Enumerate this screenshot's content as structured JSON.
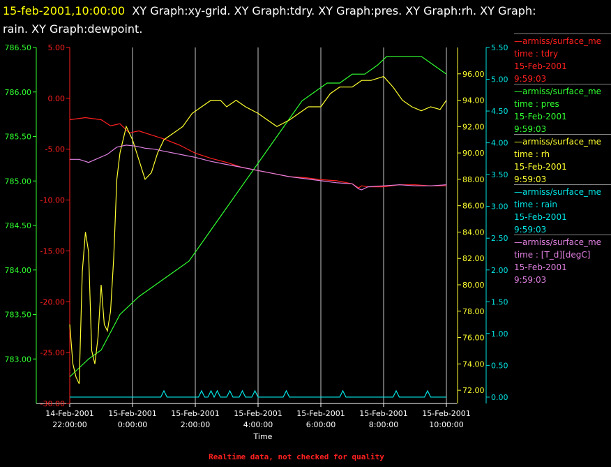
{
  "title": {
    "date": "15-feb-2001,10:00:00",
    "text_line1": "XY Graph:xy-grid.  XY Graph:tdry.  XY Graph:pres.  XY Graph:rh.  XY Graph:",
    "text_line2": "rain.  XY Graph:dewpoint."
  },
  "legend": [
    {
      "name": "armiss/surface_me",
      "var": "time : tdry",
      "date": "15-Feb-2001",
      "time": "9:59:03",
      "color": "#ff2020"
    },
    {
      "name": "armiss/surface_me",
      "var": "time : pres",
      "date": "15-Feb-2001",
      "time": "9:59:03",
      "color": "#30ff30"
    },
    {
      "name": "armiss/surface_me",
      "var": "time : rh",
      "date": "15-Feb-2001",
      "time": "9:59:03",
      "color": "#ffff30"
    },
    {
      "name": "armiss/surface_me",
      "var": "time : rain",
      "date": "15-Feb-2001",
      "time": "9:59:03",
      "color": "#00e5e5"
    },
    {
      "name": "armiss/surface_me",
      "var": "time : [T_d][degC]",
      "date": "15-Feb-2001",
      "time": "9:59:03",
      "color": "#e080e0"
    }
  ],
  "footer": "Realtime data, not checked for quality",
  "chart_data": {
    "type": "line",
    "xlabel": "Time",
    "x_domain_hours": [
      21.4,
      22.1
    ],
    "x_ticks": [
      {
        "value": 22,
        "line1": "14-Feb-2001",
        "line2": "22:00:00"
      },
      {
        "value": 24,
        "line1": "15-Feb-2001",
        "line2": "0:00:00"
      },
      {
        "value": 26,
        "line1": "15-Feb-2001",
        "line2": "2:00:00"
      },
      {
        "value": 28,
        "line1": "15-Feb-2001",
        "line2": "4:00:00"
      },
      {
        "value": 30,
        "line1": "15-Feb-2001",
        "line2": "6:00:00"
      },
      {
        "value": 32,
        "line1": "15-Feb-2001",
        "line2": "8:00:00"
      },
      {
        "value": 34,
        "line1": "15-Feb-2001",
        "line2": "10:00:00"
      }
    ],
    "x_range": [
      22,
      34
    ],
    "grid": "vertical",
    "axes": {
      "pres": {
        "range": [
          782.5,
          786.5
        ],
        "ticks": [
          "783.00",
          "783.50",
          "784.00",
          "784.50",
          "785.00",
          "785.50",
          "786.00",
          "786.50"
        ],
        "color": "#30ff30"
      },
      "tdry": {
        "range": [
          -30,
          5
        ],
        "ticks": [
          "-30.00",
          "-25.00",
          "-20.00",
          "-15.00",
          "-10.00",
          "-5.00",
          "0.00",
          "5.00"
        ],
        "color": "#ff2020"
      },
      "rh": {
        "range": [
          71,
          98
        ],
        "ticks": [
          "72.00",
          "74.00",
          "76.00",
          "78.00",
          "80.00",
          "82.00",
          "84.00",
          "86.00",
          "88.00",
          "90.00",
          "92.00",
          "94.00",
          "96.00"
        ],
        "color": "#ffff30"
      },
      "rain": {
        "range": [
          -0.1,
          5.5
        ],
        "ticks": [
          "0.00",
          "0.50",
          "1.00",
          "1.50",
          "2.00",
          "2.50",
          "3.00",
          "3.50",
          "4.00",
          "4.50",
          "5.00",
          "5.50"
        ],
        "color": "#00e5e5"
      }
    },
    "series": [
      {
        "name": "tdry",
        "axis": "tdry",
        "color": "#ff2020",
        "x": [
          22.0,
          22.5,
          23.0,
          23.3,
          23.6,
          23.9,
          24.2,
          24.6,
          25.0,
          25.5,
          26.0,
          26.5,
          27.0,
          27.5,
          28.0,
          28.5,
          29.0,
          29.5,
          30.0,
          30.5,
          31.0,
          31.2,
          31.3,
          31.5,
          32.0,
          32.5,
          33.0,
          33.5,
          34.0
        ],
        "y": [
          -2.1,
          -1.9,
          -2.1,
          -2.7,
          -2.5,
          -3.4,
          -3.2,
          -3.6,
          -4.0,
          -4.6,
          -5.4,
          -5.9,
          -6.3,
          -6.8,
          -7.1,
          -7.4,
          -7.7,
          -7.8,
          -8.0,
          -8.1,
          -8.4,
          -8.8,
          -8.6,
          -8.7,
          -8.7,
          -8.5,
          -8.5,
          -8.6,
          -8.6
        ]
      },
      {
        "name": "pres",
        "axis": "pres",
        "color": "#30ff30",
        "x": [
          22.0,
          22.3,
          22.6,
          23.0,
          23.3,
          23.6,
          23.9,
          24.2,
          24.6,
          25.0,
          25.4,
          25.8,
          26.2,
          26.6,
          27.0,
          27.4,
          27.8,
          28.2,
          28.6,
          29.0,
          29.4,
          29.8,
          30.2,
          30.6,
          31.0,
          31.4,
          31.8,
          32.1,
          32.4,
          32.8,
          33.2,
          33.6,
          34.0
        ],
        "y": [
          782.8,
          782.9,
          783.0,
          783.1,
          783.3,
          783.5,
          783.6,
          783.7,
          783.8,
          783.9,
          784.0,
          784.1,
          784.3,
          784.5,
          784.7,
          784.9,
          785.1,
          785.3,
          785.5,
          785.7,
          785.9,
          786.0,
          786.1,
          786.1,
          786.2,
          786.2,
          786.3,
          786.4,
          786.4,
          786.4,
          786.4,
          786.3,
          786.2
        ]
      },
      {
        "name": "rh",
        "axis": "rh",
        "color": "#ffff30",
        "x": [
          22.0,
          22.1,
          22.2,
          22.3,
          22.4,
          22.5,
          22.6,
          22.7,
          22.8,
          22.9,
          23.0,
          23.1,
          23.2,
          23.3,
          23.4,
          23.5,
          23.6,
          23.8,
          24.0,
          24.2,
          24.4,
          24.6,
          24.8,
          25.0,
          25.3,
          25.6,
          25.9,
          26.2,
          26.5,
          26.8,
          27.0,
          27.3,
          27.6,
          28.0,
          28.3,
          28.6,
          29.0,
          29.3,
          29.6,
          30.0,
          30.3,
          30.6,
          31.0,
          31.3,
          31.6,
          32.0,
          32.3,
          32.6,
          32.9,
          33.2,
          33.5,
          33.8,
          34.0
        ],
        "y": [
          77.0,
          74.0,
          73.0,
          72.5,
          81.0,
          84.0,
          82.5,
          75.0,
          74.0,
          76.0,
          80.0,
          77.0,
          76.5,
          78.0,
          82.0,
          88.0,
          90.0,
          92.0,
          91.0,
          89.5,
          88.0,
          88.5,
          90.0,
          91.0,
          91.5,
          92.0,
          93.0,
          93.5,
          94.0,
          94.0,
          93.5,
          94.0,
          93.5,
          93.0,
          92.5,
          92.0,
          92.5,
          93.0,
          93.5,
          93.5,
          94.5,
          95.0,
          95.0,
          95.5,
          95.5,
          95.8,
          95.0,
          94.0,
          93.5,
          93.2,
          93.5,
          93.3,
          94.0
        ]
      },
      {
        "name": "rain",
        "axis": "rain",
        "color": "#00e5e5",
        "x": [
          22.0,
          24.9,
          25.0,
          25.1,
          26.1,
          26.2,
          26.3,
          26.4,
          26.5,
          26.6,
          26.7,
          26.8,
          27.0,
          27.1,
          27.2,
          27.4,
          27.5,
          27.6,
          27.8,
          27.9,
          28.0,
          28.8,
          28.9,
          29.0,
          30.6,
          30.7,
          30.8,
          32.3,
          32.4,
          32.5,
          33.3,
          33.4,
          33.5,
          34.0
        ],
        "y": [
          0,
          0,
          0.1,
          0,
          0,
          0.1,
          0,
          0,
          0.1,
          0,
          0.1,
          0,
          0,
          0.1,
          0,
          0,
          0.1,
          0,
          0,
          0.1,
          0,
          0,
          0.1,
          0,
          0,
          0.1,
          0,
          0,
          0.1,
          0,
          0,
          0.1,
          0,
          0
        ]
      },
      {
        "name": "[T_d][degC]",
        "axis": "tdry",
        "color": "#e080e0",
        "x": [
          22.0,
          22.3,
          22.6,
          22.9,
          23.2,
          23.5,
          23.8,
          24.1,
          24.4,
          24.7,
          25.0,
          25.5,
          26.0,
          26.5,
          27.0,
          27.5,
          28.0,
          28.5,
          29.0,
          29.5,
          30.0,
          30.5,
          31.0,
          31.2,
          31.3,
          31.5,
          32.0,
          32.5,
          33.0,
          33.5,
          34.0
        ],
        "y": [
          -6.0,
          -6.0,
          -6.3,
          -5.9,
          -5.5,
          -4.8,
          -4.6,
          -4.7,
          -4.9,
          -5.0,
          -5.2,
          -5.5,
          -5.8,
          -6.2,
          -6.5,
          -6.8,
          -7.1,
          -7.4,
          -7.7,
          -7.9,
          -8.1,
          -8.3,
          -8.4,
          -8.9,
          -9.0,
          -8.7,
          -8.6,
          -8.5,
          -8.6,
          -8.6,
          -8.5
        ]
      }
    ]
  }
}
